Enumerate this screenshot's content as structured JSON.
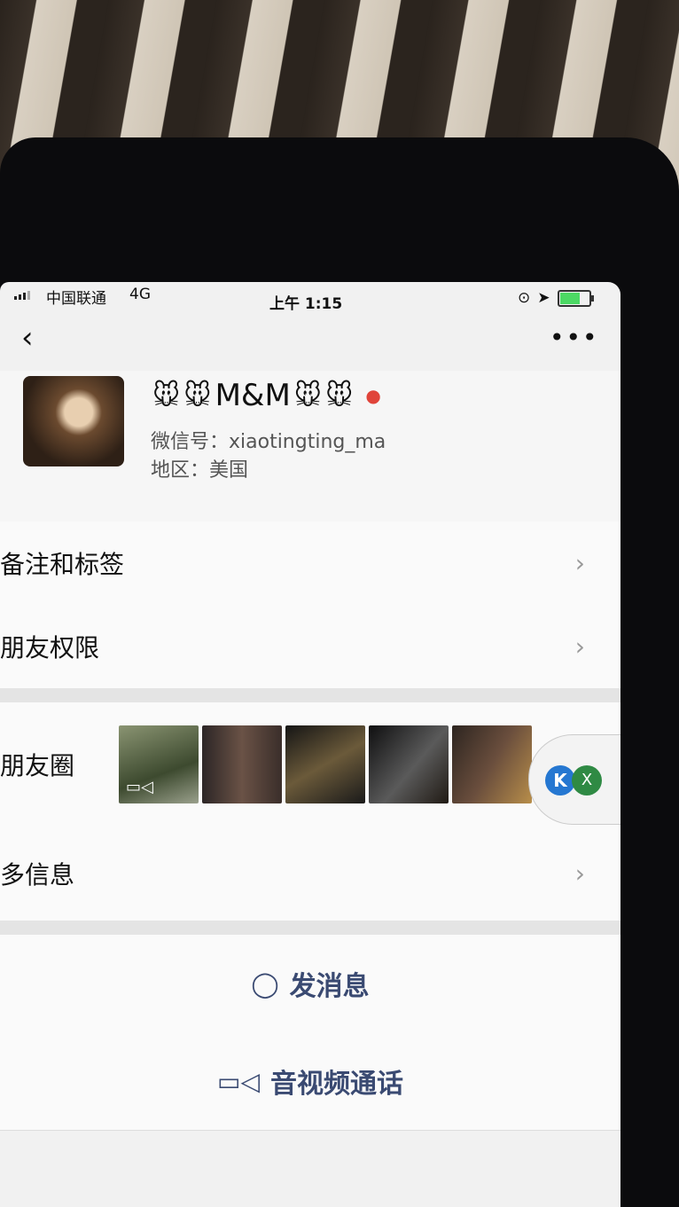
{
  "status_bar": {
    "carrier": "中国联通",
    "network": "4G",
    "time": "上午 1:15"
  },
  "nav": {
    "back_icon": "chevron-left-icon",
    "more_icon": "more-dots-icon",
    "more_label": "•••"
  },
  "profile": {
    "name_emoji": "🐭",
    "name": "M&M",
    "gender_icon": "female-icon",
    "wechat_id": "微信号：xiaotingting_ma",
    "region": "地区：美国"
  },
  "cells": {
    "remark_tags": "备注和标签",
    "friend_permissions": "朋友权限",
    "moments": "朋友圈",
    "more_info": "多信息"
  },
  "actions": {
    "send_message": "发消息",
    "av_call": "音视频通话"
  },
  "floater": {
    "badge_1": "K",
    "badge_2": "X"
  },
  "colors": {
    "accent_action": "#3a4a72",
    "female_badge": "#e0443a"
  }
}
